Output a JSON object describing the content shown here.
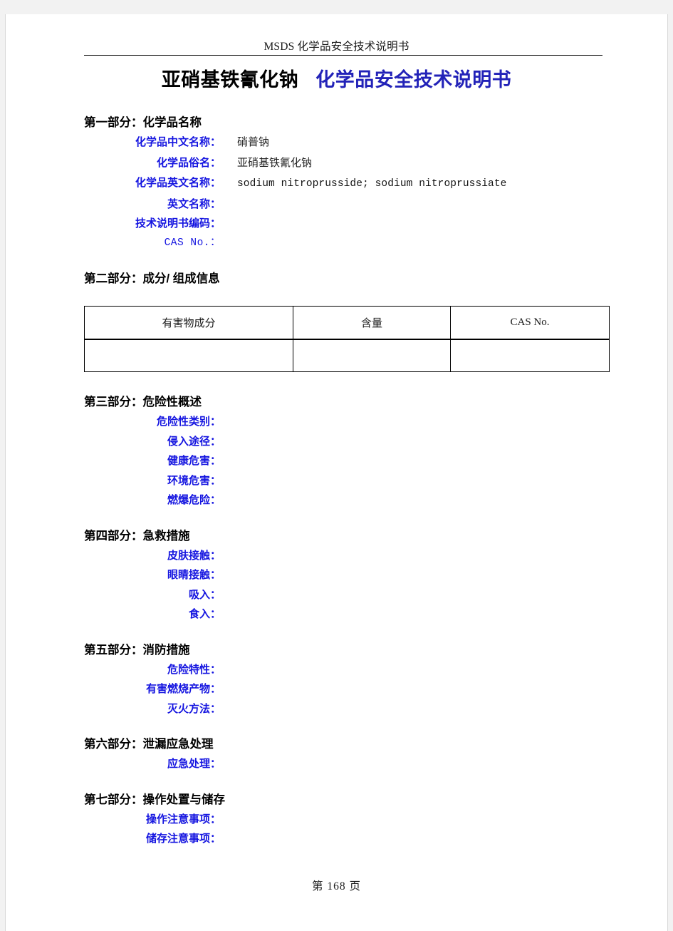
{
  "running_head": "MSDS 化学品安全技术说明书",
  "title": {
    "substance": "亚硝基铁氰化钠",
    "doc_type": "化学品安全技术说明书",
    "black_color": "#000000",
    "blue_color": "#2222b8"
  },
  "label_color": "#1515e0",
  "sections": {
    "s1": {
      "heading": "第一部分：化学品名称",
      "fields": [
        {
          "label": "化学品中文名称：",
          "value": "硝普钠"
        },
        {
          "label": "化学品俗名：",
          "value": "亚硝基铁氰化钠"
        },
        {
          "label": "化学品英文名称：",
          "value": "sodium nitroprusside; sodium nitroprussiate"
        },
        {
          "label": "英文名称：",
          "value": ""
        },
        {
          "label": "技术说明书编码：",
          "value": ""
        },
        {
          "label": "CAS No.：",
          "value": ""
        }
      ]
    },
    "s2": {
      "heading": "第二部分：成分/ 组成信息",
      "table": {
        "headers": [
          "有害物成分",
          "含量",
          "CAS No."
        ],
        "rows": [
          [
            "",
            "",
            ""
          ]
        ]
      }
    },
    "s3": {
      "heading": "第三部分：危险性概述",
      "fields": [
        {
          "label": "危险性类别：",
          "value": ""
        },
        {
          "label": "侵入途径：",
          "value": ""
        },
        {
          "label": "健康危害：",
          "value": ""
        },
        {
          "label": "环境危害：",
          "value": ""
        },
        {
          "label": "燃爆危险：",
          "value": ""
        }
      ]
    },
    "s4": {
      "heading": "第四部分：急救措施",
      "fields": [
        {
          "label": "皮肤接触：",
          "value": ""
        },
        {
          "label": "眼睛接触：",
          "value": ""
        },
        {
          "label": "吸入：",
          "value": ""
        },
        {
          "label": "食入：",
          "value": ""
        }
      ]
    },
    "s5": {
      "heading": "第五部分：消防措施",
      "fields": [
        {
          "label": "危险特性：",
          "value": ""
        },
        {
          "label": "有害燃烧产物：",
          "value": ""
        },
        {
          "label": "灭火方法：",
          "value": ""
        }
      ]
    },
    "s6": {
      "heading": "第六部分：泄漏应急处理",
      "fields": [
        {
          "label": "应急处理：",
          "value": ""
        }
      ]
    },
    "s7": {
      "heading": "第七部分：操作处置与储存",
      "fields": [
        {
          "label": "操作注意事项：",
          "value": ""
        },
        {
          "label": "储存注意事项：",
          "value": ""
        }
      ]
    }
  },
  "footer": "第 168 页"
}
